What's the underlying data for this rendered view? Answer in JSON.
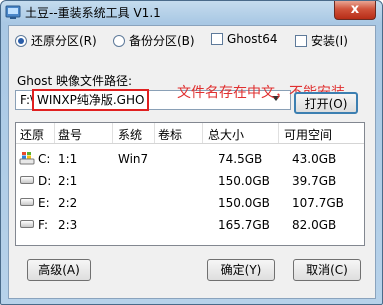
{
  "window": {
    "title": "土豆--重装系统工具 V1.1",
    "close_label": "x"
  },
  "options": {
    "restore_label": "还原分区(R)",
    "backup_label": "备份分区(B)",
    "ghost64_label": "Ghost64",
    "install_label": "安装(I)",
    "selected": "restore"
  },
  "path": {
    "label": "Ghost 映像文件路径:",
    "drive_prefix": "F:\\",
    "filename": "WINXP纯净版.GHO",
    "note": "文件名存在中文，不能安装",
    "open_label": "打开(O)"
  },
  "table": {
    "columns": [
      "还原",
      "盘号",
      "系统",
      "卷标",
      "总大小",
      "可用空间"
    ],
    "rows": [
      {
        "drive": "C:",
        "num": "1:1",
        "system": "Win7",
        "label": "",
        "total": "74.5GB",
        "free": "43.0GB",
        "icon": "windows-drive-icon"
      },
      {
        "drive": "D:",
        "num": "2:1",
        "system": "",
        "label": "",
        "total": "150.0GB",
        "free": "39.7GB",
        "icon": "drive-icon"
      },
      {
        "drive": "E:",
        "num": "2:2",
        "system": "",
        "label": "",
        "total": "150.0GB",
        "free": "107.7GB",
        "icon": "drive-icon"
      },
      {
        "drive": "F:",
        "num": "2:3",
        "system": "",
        "label": "",
        "total": "165.7GB",
        "free": "82.0GB",
        "icon": "drive-icon"
      }
    ]
  },
  "buttons": {
    "advanced": "高级(A)",
    "ok": "确定(Y)",
    "cancel": "取消(C)"
  }
}
